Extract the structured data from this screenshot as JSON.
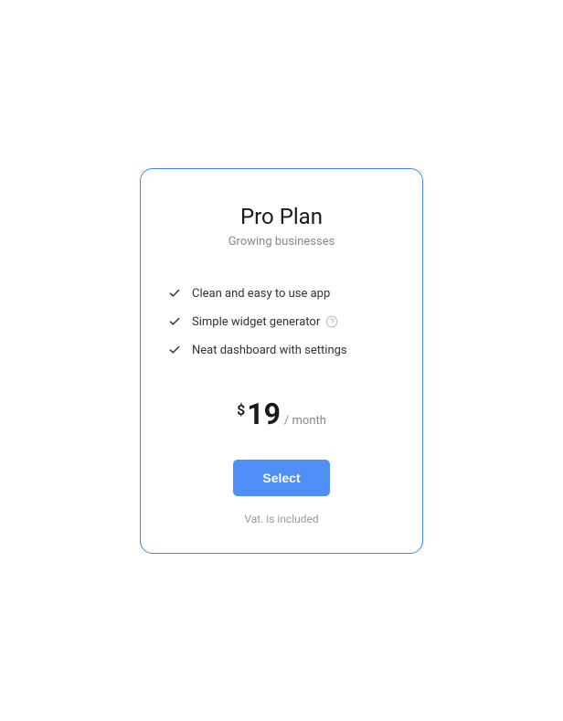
{
  "plan": {
    "title": "Pro Plan",
    "subtitle": "Growing businesses",
    "features": [
      {
        "label": "Clean and easy to use app",
        "help": false
      },
      {
        "label": "Simple widget generator",
        "help": true
      },
      {
        "label": "Neat dashboard with settings",
        "help": false
      }
    ],
    "currency": "$",
    "amount": "19",
    "period": "/ month",
    "cta": "Select",
    "vat_note": "Vat. is included"
  }
}
